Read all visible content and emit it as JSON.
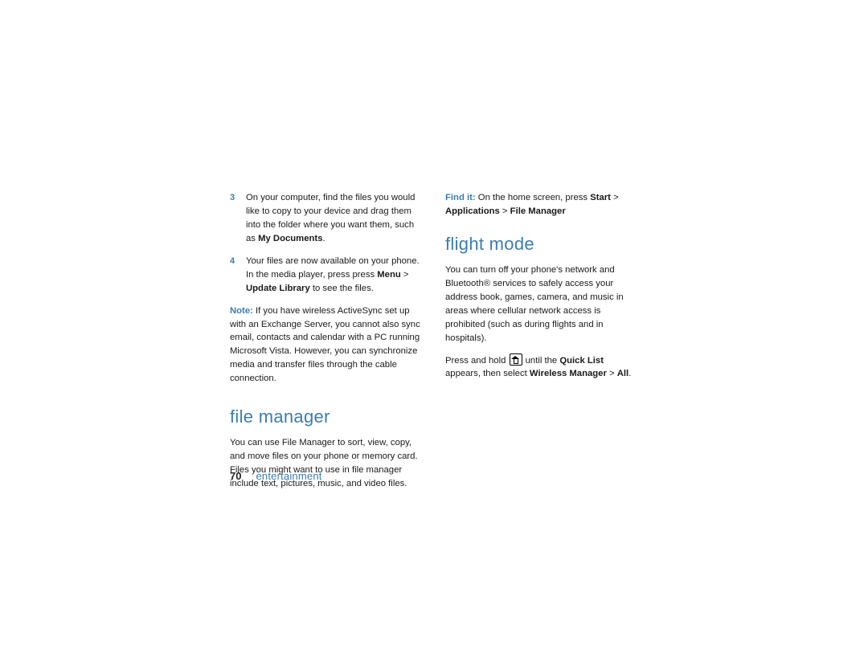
{
  "col1": {
    "item3": {
      "num": "3",
      "text_a": "On your computer, find the files you would like to copy to your device and drag them into the folder where you want them, such as ",
      "myDocs": "My Documents",
      "period1": "."
    },
    "item4": {
      "num": "4",
      "text_a": "Your files are now available on your phone. In the media player, press press ",
      "menu": "Menu",
      "gt": " > ",
      "updateLib": "Update Library",
      "text_b": " to see the files."
    },
    "note": {
      "label": "Note:",
      "text": " If you have wireless ActiveSync set up with an Exchange Server, you cannot also sync email, contacts and calendar with a PC running Microsoft Vista. However, you can synchronize media and transfer files through the cable connection."
    },
    "h2_fm": "file manager",
    "fm_body": "You can use File Manager to sort, view, copy, and move files on your phone or memory card. Files you might want to use in file manager include text, pictures, music, and video files."
  },
  "col2": {
    "findit_label": "Find it:",
    "findit_a": " On the home screen, press ",
    "start": "Start",
    "gt1": " > ",
    "apps": "Applications",
    "gt2": " > ",
    "fileMgr": "File Manager",
    "h2_flight": "flight mode",
    "flight_body": "You can turn off your phone's network and Bluetooth® services to safely access your address book, games, camera, and music in areas where cellular network access is prohibited (such as during flights and in hospitals).",
    "press_a": "Press and hold ",
    "press_b": " until the ",
    "quicklist": "Quick List",
    "press_c": " appears, then select ",
    "wireless": "Wireless Manager",
    "gt3": " > ",
    "all": "All",
    "period2": "."
  },
  "footer": {
    "page": "70",
    "section": "entertainment"
  }
}
